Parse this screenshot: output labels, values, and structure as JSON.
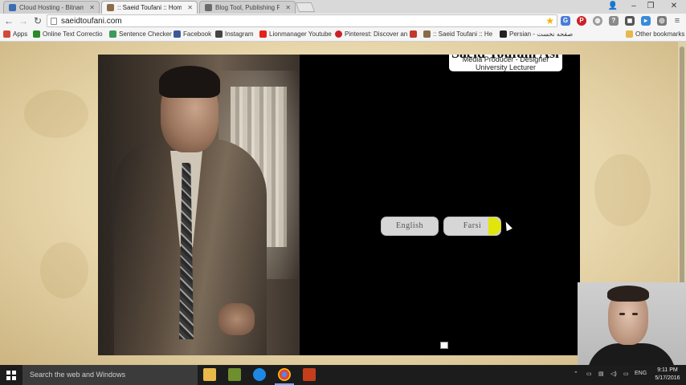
{
  "browser": {
    "tabs": [
      {
        "title": "Cloud Hosting - Bitnami",
        "active": false,
        "favicon_color": "#3b6db3"
      },
      {
        "title": ":: Saeid Toufani :: Home",
        "active": true,
        "favicon_color": "#8a6b4a"
      },
      {
        "title": "Blog Tool, Publishing Platf",
        "active": false,
        "favicon_color": "#6a6a6a"
      }
    ],
    "window_controls": {
      "minimize": "–",
      "maximize": "❐",
      "close": "✕"
    },
    "url": "saeidtoufani.com",
    "bookmarks": [
      {
        "label": "Apps",
        "icon_color": "#d04a3a"
      },
      {
        "label": "Online Text Correctio",
        "icon_color": "#2a8a2a"
      },
      {
        "label": "Sentence Checker",
        "icon_color": "#3c9a5a"
      },
      {
        "label": "Facebook",
        "icon_color": "#3b5998"
      },
      {
        "label": "Instagram",
        "icon_color": "#444444"
      },
      {
        "label": "Lionmanager Youtube",
        "icon_color": "#e62117"
      },
      {
        "label": "Pinterest: Discover an",
        "icon_color": "#cb2027"
      },
      {
        "label": ":: Saeid Toufani :: He",
        "icon_color": "#8a6b4a"
      },
      {
        "label": "Persian - صفحه نخست",
        "icon_color": "#222222"
      }
    ],
    "other_bookmarks": "Other bookmarks"
  },
  "page": {
    "name": "Saeid Toufani Asl",
    "subtitle_line1": "Media Producer - Designer",
    "subtitle_line2": "University Lecturer",
    "buttons": {
      "english": "English",
      "farsi": "Farsi"
    }
  },
  "taskbar": {
    "search_placeholder": "Search the web and Windows",
    "language": "ENG",
    "time": "9:11 PM",
    "date": "5/17/2016"
  }
}
